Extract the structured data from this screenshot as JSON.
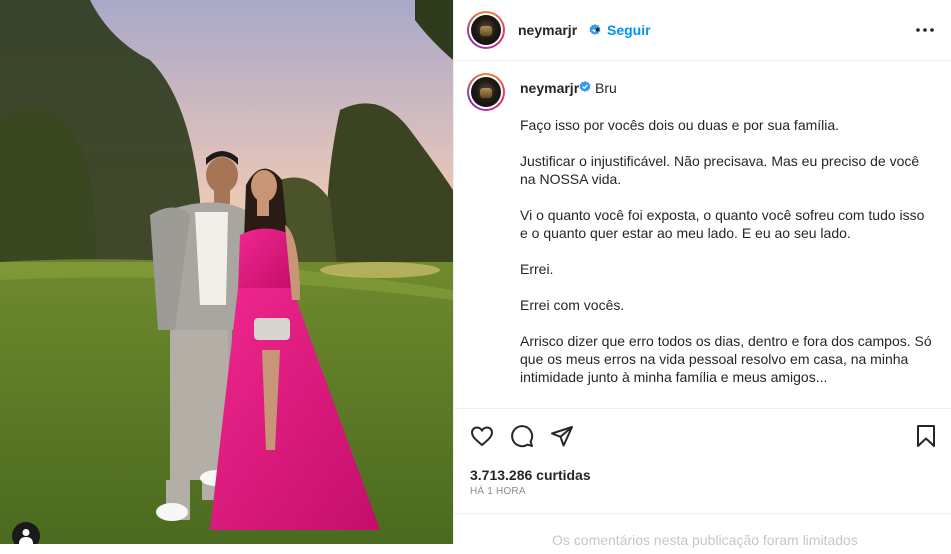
{
  "post": {
    "username": "neymarjr",
    "separator": "•",
    "follow_label": "Seguir",
    "more_icon": "more-horizontal-icon",
    "verified_icon": "verified-badge-icon"
  },
  "caption": {
    "username": "neymarjr",
    "mention": "Bru",
    "text": "Faço isso por vocês dois ou duas e por sua família.\n\nJustificar o injustificável. Não precisava. Mas eu preciso de você na NOSSA vida.\n\nVi o quanto você foi exposta, o quanto você sofreu com tudo isso e o quanto quer estar ao meu lado. E eu ao seu lado.\n\nErrei.\n\nErrei com vocês.\n\nArrisco dizer que erro todos os dias, dentro e fora dos campos. Só que os meus erros na vida pessoal resolvo em casa, na minha intimidade junto à minha família e meus amigos..."
  },
  "actions": {
    "like_icon": "heart-icon",
    "comment_icon": "comment-icon",
    "share_icon": "share-icon",
    "save_icon": "bookmark-icon",
    "likes_label": "3.713.286 curtidas",
    "time_label": "HÁ 1 HORA"
  },
  "comments": {
    "limited_note": "Os comentários nesta publicação foram limitados"
  },
  "photo": {
    "tag_icon": "user-tag-icon"
  },
  "colors": {
    "accent": "#0095f6",
    "verified": "#3897f0",
    "dress": "#e4127c"
  }
}
